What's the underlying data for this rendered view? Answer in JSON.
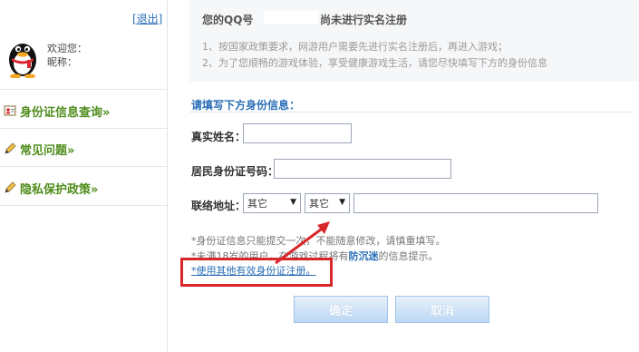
{
  "sidebar": {
    "logout_label": "[退出]",
    "welcome_label": "欢迎您：",
    "nickname_label": "昵称：",
    "items": [
      {
        "label": "身份证信息查询»",
        "icon": "id-card-icon"
      },
      {
        "label": "常见问题»",
        "icon": "pencil-icon"
      },
      {
        "label": "隐私保护政策»",
        "icon": "pencil-icon"
      }
    ],
    "accent_color": "#4f8d1c"
  },
  "banner": {
    "title": "您的QQ号",
    "status": "尚未进行实名注册",
    "notices": [
      "1、按国家政策要求，网游用户需要先进行实名注册后，再进入游戏；",
      "2、为了您顺畅的游戏体验，享受健康游戏生活，请您尽快填写下方的身份信息"
    ]
  },
  "form": {
    "section_title": "请填写下方身份信息：",
    "name_label": "真实姓名：",
    "name_value": "",
    "id_label": "居民身份证号码：",
    "id_value": "",
    "address_label": "联络地址：",
    "province_selected": "其它",
    "city_selected": "其它",
    "address_value": "",
    "notes": [
      "*身份证信息只能提交一次，不能随意修改，请慎重填写。",
      "*未满18岁的用户，在游戏过程将有",
      "防沉迷",
      "的信息提示。"
    ],
    "alt_id_link": "*使用其他有效身份证注册。",
    "confirm_label": "确定",
    "cancel_label": "取消"
  },
  "colors": {
    "link": "#2a6fb7",
    "highlight_box": "#d9262b",
    "button_top": "#e6f1fc",
    "button_bottom": "#bcd8f4"
  }
}
